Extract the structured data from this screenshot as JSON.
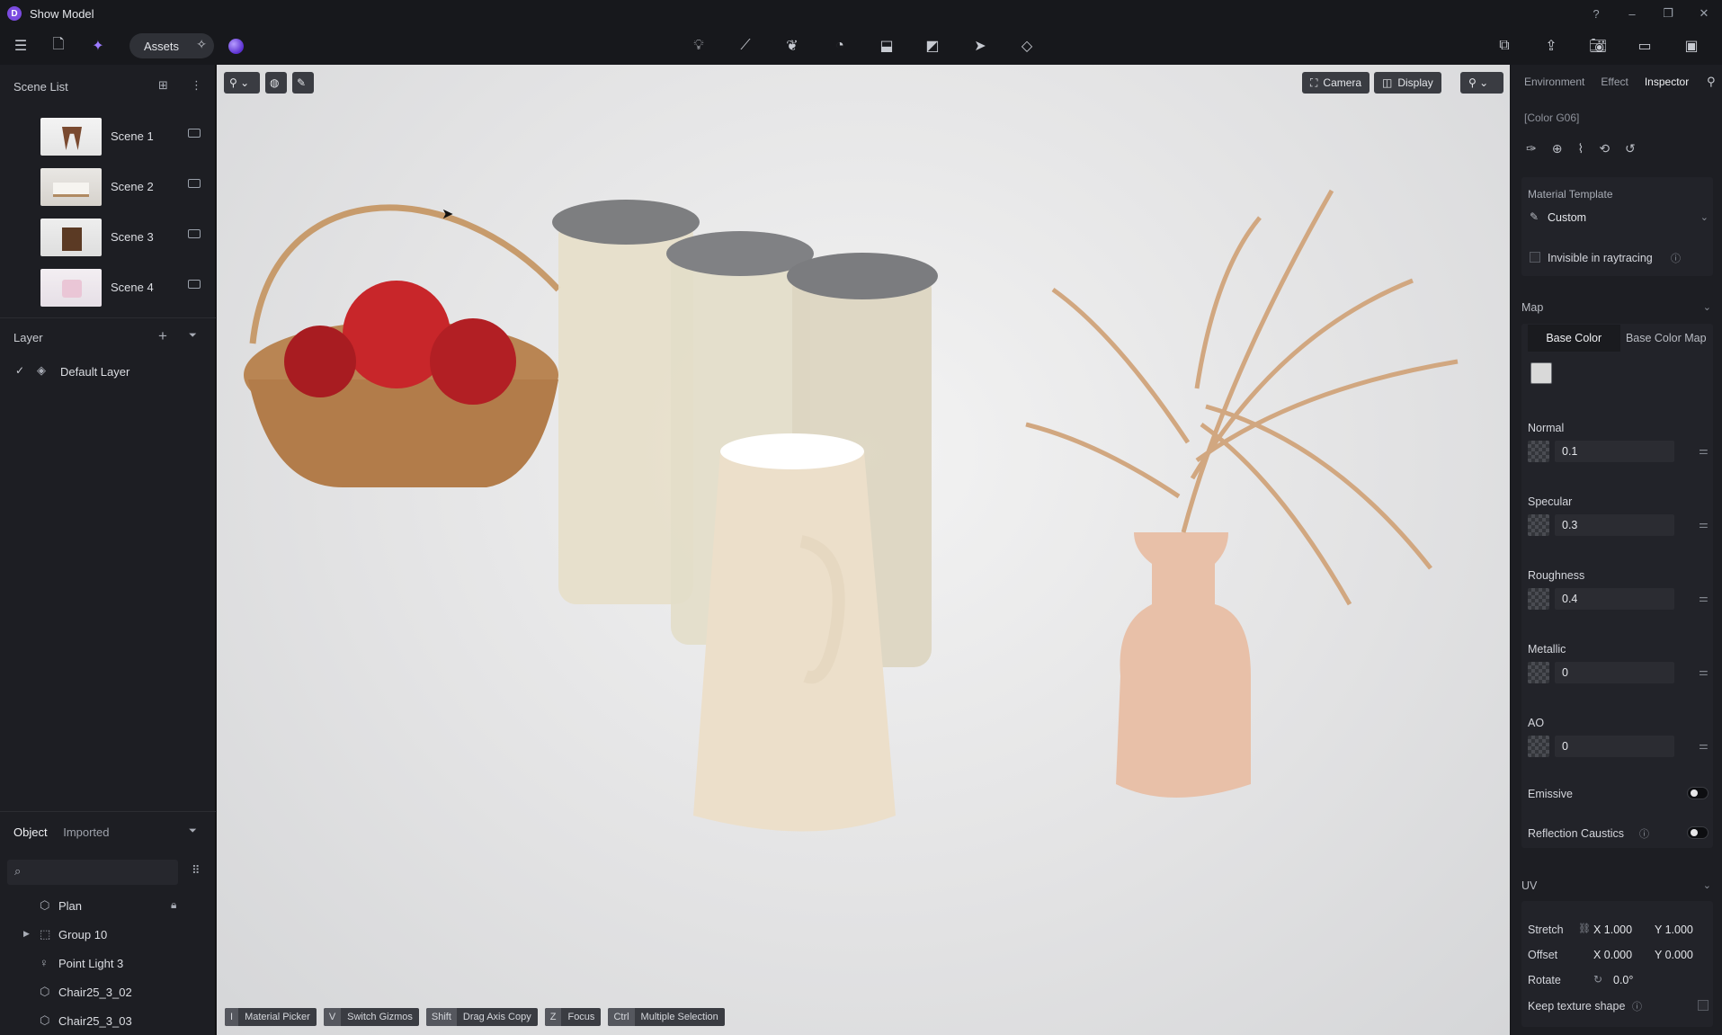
{
  "app": {
    "title": "Show Model"
  },
  "toolbar": {
    "assets_label": "Assets"
  },
  "scene_list": {
    "title": "Scene List",
    "scenes": [
      {
        "name": "Scene 1"
      },
      {
        "name": "Scene 2"
      },
      {
        "name": "Scene 3"
      },
      {
        "name": "Scene 4"
      }
    ]
  },
  "layer": {
    "title": "Layer",
    "items": [
      {
        "name": "Default Layer"
      }
    ]
  },
  "objects": {
    "tabs": [
      "Object",
      "Imported"
    ],
    "tree": [
      {
        "name": "Plan",
        "icon": "cube-icon"
      },
      {
        "name": "Group 10",
        "icon": "group-icon"
      },
      {
        "name": "Point Light 3",
        "icon": "light-bulb-icon"
      },
      {
        "name": "Chair25_3_02",
        "icon": "cube-icon"
      },
      {
        "name": "Chair25_3_03",
        "icon": "cube-icon"
      }
    ]
  },
  "viewport": {
    "camera_label": "Camera",
    "display_label": "Display",
    "hints": [
      {
        "key": "I",
        "label": "Material Picker"
      },
      {
        "key": "V",
        "label": "Switch Gizmos"
      },
      {
        "key": "Shift",
        "label": "Drag Axis Copy"
      },
      {
        "key": "Z",
        "label": "Focus"
      },
      {
        "key": "Ctrl",
        "label": "Multiple Selection"
      }
    ]
  },
  "inspector": {
    "tabs": [
      "Environment",
      "Effect",
      "Inspector"
    ],
    "material_name": "[Color G06]",
    "material_template_label": "Material Template",
    "material_template_value": "Custom",
    "invisible_label": "Invisible in raytracing",
    "map_title": "Map",
    "map_tabs": [
      "Base Color",
      "Base Color Map"
    ],
    "normal": {
      "label": "Normal",
      "value": "0.1"
    },
    "specular": {
      "label": "Specular",
      "value": "0.3"
    },
    "roughness": {
      "label": "Roughness",
      "value": "0.4"
    },
    "metallic": {
      "label": "Metallic",
      "value": "0"
    },
    "ao": {
      "label": "AO",
      "value": "0"
    },
    "emissive_label": "Emissive",
    "caustics_label": "Reflection Caustics",
    "uv_title": "UV",
    "stretch": {
      "label": "Stretch",
      "x": "X 1.000",
      "y": "Y 1.000"
    },
    "offset": {
      "label": "Offset",
      "x": "X 0.000",
      "y": "Y 0.000"
    },
    "rotate": {
      "label": "Rotate",
      "value": "0.0°"
    },
    "keep_label": "Keep texture shape"
  }
}
